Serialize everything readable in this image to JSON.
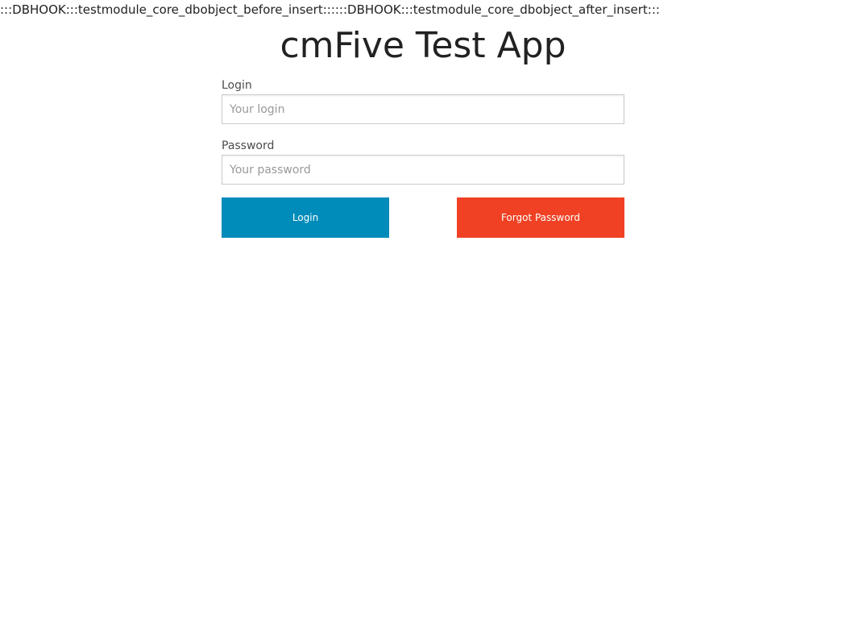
{
  "debug": {
    "hook_text": ":::DBHOOK:::testmodule_core_dbobject_before_insert::::::DBHOOK:::testmodule_core_dbobject_after_insert:::"
  },
  "app": {
    "title": "cmFive Test App"
  },
  "form": {
    "login_label": "Login",
    "login_placeholder": "Your login",
    "login_value": "",
    "password_label": "Password",
    "password_placeholder": "Your password",
    "password_value": ""
  },
  "buttons": {
    "login_label": "Login",
    "forgot_label": "Forgot Password"
  },
  "colors": {
    "login_button": "#008cba",
    "forgot_button": "#f04124"
  }
}
